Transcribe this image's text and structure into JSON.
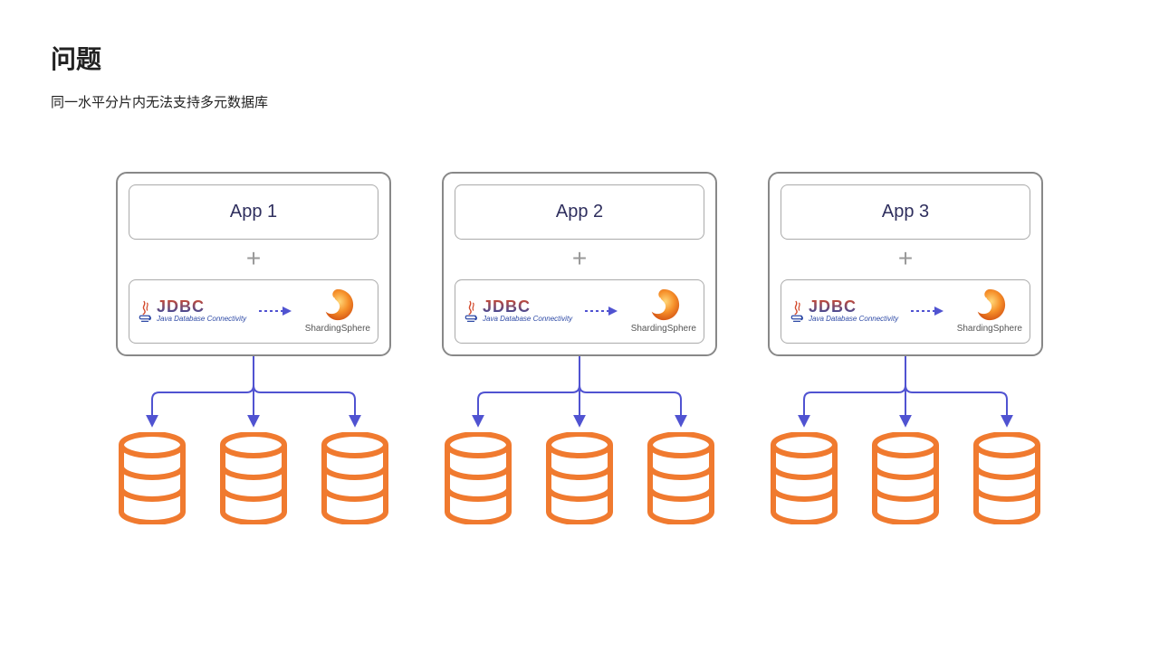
{
  "title": "问题",
  "subtitle": "同一水平分片内无法支持多元数据库",
  "groups": [
    {
      "app_label": "App 1",
      "plus": "+",
      "jdbc": {
        "main": "JDBC",
        "sub": "Java Database Connectivity"
      },
      "ss_label": "ShardingSphere"
    },
    {
      "app_label": "App 2",
      "plus": "+",
      "jdbc": {
        "main": "JDBC",
        "sub": "Java Database Connectivity"
      },
      "ss_label": "ShardingSphere"
    },
    {
      "app_label": "App 3",
      "plus": "+",
      "jdbc": {
        "main": "JDBC",
        "sub": "Java Database Connectivity"
      },
      "ss_label": "ShardingSphere"
    }
  ],
  "colors": {
    "frame_border": "#888888",
    "inner_border": "#aaaaaa",
    "arrow": "#5053d1",
    "db": "#f07a2f",
    "jdbc_grad_top": "#d34a2c",
    "jdbc_grad_bot": "#2e4aa6"
  },
  "icons": {
    "java_cup": "java-cup-icon",
    "sharding_sphere": "shardingsphere-logo-icon",
    "database": "database-icon",
    "plus": "plus-icon",
    "dotted_arrow": "dotted-arrow-icon"
  }
}
